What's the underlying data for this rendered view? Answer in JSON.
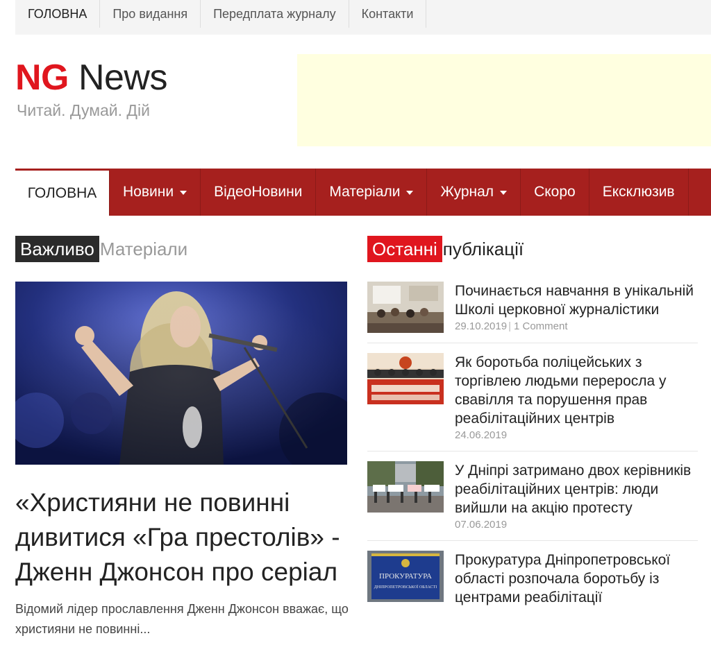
{
  "topbar": {
    "items": [
      "ГОЛОВНА",
      "Про видання",
      "Передплата журналу",
      "Контакти"
    ]
  },
  "logo": {
    "ng": "NG",
    "news": "News",
    "tagline": "Читай. Думай. Дій"
  },
  "mainnav": {
    "items": [
      {
        "label": "ГОЛОВНА",
        "caret": false
      },
      {
        "label": "Новини",
        "caret": true
      },
      {
        "label": "ВідеоНовини",
        "caret": false
      },
      {
        "label": "Матеріали",
        "caret": true
      },
      {
        "label": "Журнал",
        "caret": true
      },
      {
        "label": "Скоро",
        "caret": false
      },
      {
        "label": "Ексклюзив",
        "caret": false
      }
    ]
  },
  "left_section": {
    "badge": "Важливо",
    "rest": "Матеріали"
  },
  "right_section": {
    "badge": "Останні",
    "rest": "публікації"
  },
  "featured": {
    "title": "«Християни не повинні дивитися «Гра престолів» - Дженн Джонсон про серіал",
    "excerpt": "Відомий лідер прославлення Дженн Джонсон вважає, що християни не повинні..."
  },
  "recent": [
    {
      "title": "Починається навчання в унікальній Школі церковної журналістики",
      "date": "29.10.2019",
      "comments": "1 Comment"
    },
    {
      "title": "Як боротьба поліцейських з торгівлею людьми переросла у свавілля та порушення прав реабілітаційних центрів",
      "date": "24.06.2019",
      "comments": ""
    },
    {
      "title": "У Дніпрі затримано двох керівників реабілітаційних центрів: люди вийшли на акцію протесту",
      "date": "07.06.2019",
      "comments": ""
    },
    {
      "title": "Прокуратура Дніпропетровської області розпочала боротьбу із центрами реабілітації",
      "date": "",
      "comments": ""
    }
  ],
  "thumb_signs": {
    "t4_line1": "ПРОКУРАТУРА",
    "t4_line2": "ДНІПРОПЕТРОВСЬКОЇ ОБЛАСТІ"
  }
}
